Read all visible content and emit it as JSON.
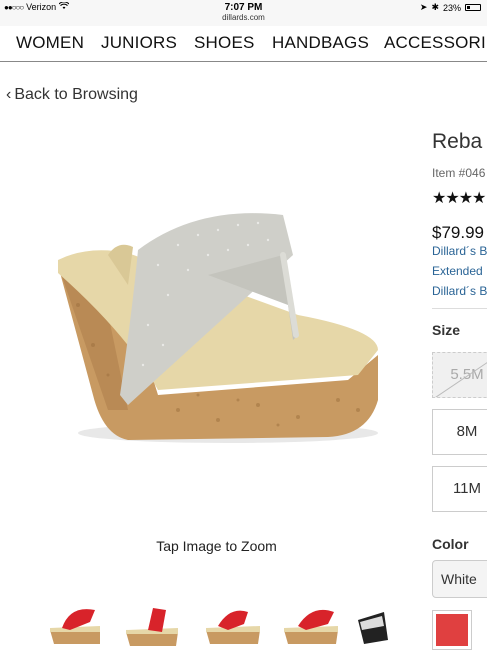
{
  "status_bar": {
    "carrier": "Verizon",
    "time": "7:07 PM",
    "url": "dillards.com",
    "battery": "23%"
  },
  "nav": {
    "items": [
      "WOMEN",
      "JUNIORS",
      "SHOES",
      "HANDBAGS",
      "ACCESSORIES"
    ]
  },
  "back_link": "Back to Browsing",
  "zoom_hint": "Tap Image to Zoom",
  "product": {
    "name": "Reba",
    "item_number": "Item #046",
    "rating_stars": "★★★★",
    "price": "$79.99",
    "links": [
      "Dillard´s B",
      "Extended",
      "Dillard´s B"
    ]
  },
  "size": {
    "label": "Size",
    "options": [
      "5.5M",
      "8M",
      "11M"
    ],
    "unavailable": [
      "5.5M"
    ]
  },
  "color": {
    "label": "Color",
    "selected": "White",
    "swatch_color": "#e04040"
  },
  "colors": {
    "link": "#2a6496",
    "cork": "#c89a62",
    "strap_silver": "#cfcfc9",
    "strap_red": "#d8232a"
  }
}
